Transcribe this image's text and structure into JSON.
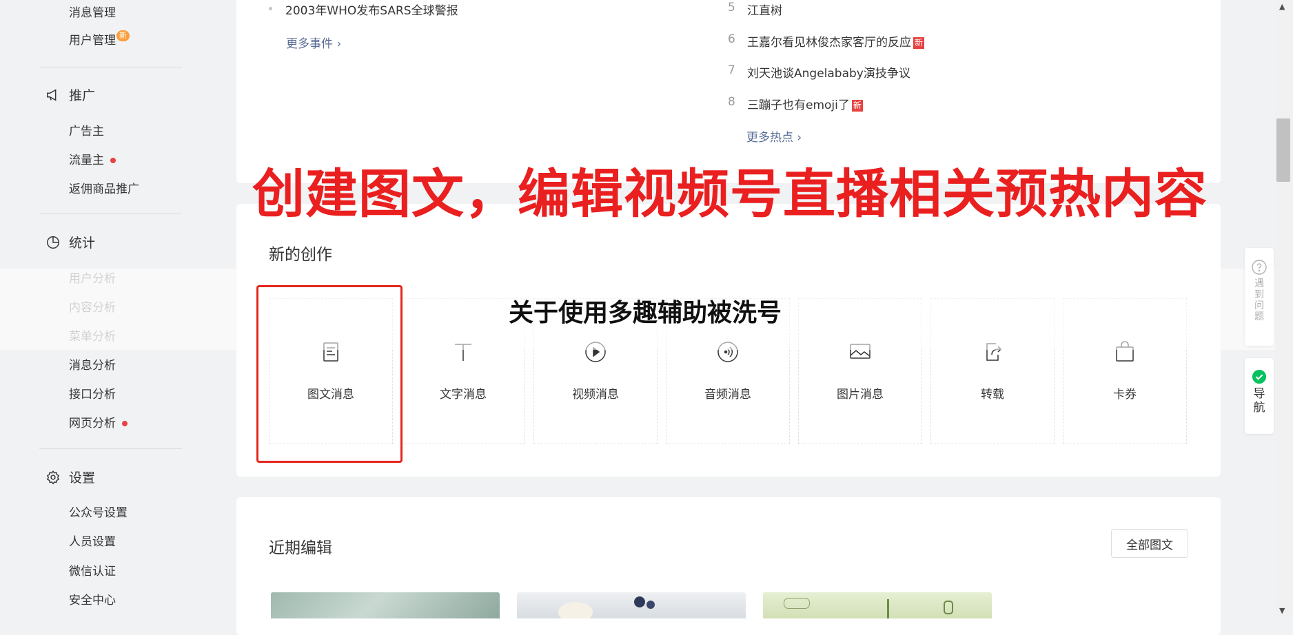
{
  "sidebar": {
    "message_mgmt": "消息管理",
    "user_mgmt": "用户管理",
    "user_mgmt_badge": "新",
    "promotion": {
      "label": "推广",
      "items": [
        "广告主",
        "流量主",
        "返佣商品推广"
      ]
    },
    "stats": {
      "label": "统计",
      "items": [
        "用户分析",
        "内容分析",
        "菜单分析",
        "消息分析",
        "接口分析",
        "网页分析"
      ]
    },
    "settings": {
      "label": "设置",
      "items": [
        "公众号设置",
        "人员设置",
        "微信认证",
        "安全中心"
      ]
    }
  },
  "events": {
    "item": "2003年WHO发布SARS全球警报",
    "more": "更多事件 ›"
  },
  "hot": {
    "items": [
      {
        "num": "5",
        "text": "江直树",
        "new": ""
      },
      {
        "num": "6",
        "text": "王嘉尔看见林俊杰家客厅的反应",
        "new": "新"
      },
      {
        "num": "7",
        "text": "刘天池谈Angelababy演技争议",
        "new": ""
      },
      {
        "num": "8",
        "text": "三蹦子也有emoji了",
        "new": "新"
      }
    ],
    "more": "更多热点 ›"
  },
  "overlay": {
    "title": "创建图文，编辑视频号直播相关预热内容",
    "subtitle": "关于使用多趣辅助被洗号"
  },
  "creation": {
    "title": "新的创作",
    "tiles": [
      "图文消息",
      "文字消息",
      "视频消息",
      "音频消息",
      "图片消息",
      "转载",
      "卡券"
    ]
  },
  "recent": {
    "title": "近期编辑",
    "all_button": "全部图文"
  },
  "floating": {
    "help": "遇到问题",
    "nav": "导航"
  },
  "colors": {
    "accent_red": "#e5261d",
    "link": "#576b95",
    "badge_orange": "#fa9d3b",
    "nav_green": "#07c160"
  }
}
